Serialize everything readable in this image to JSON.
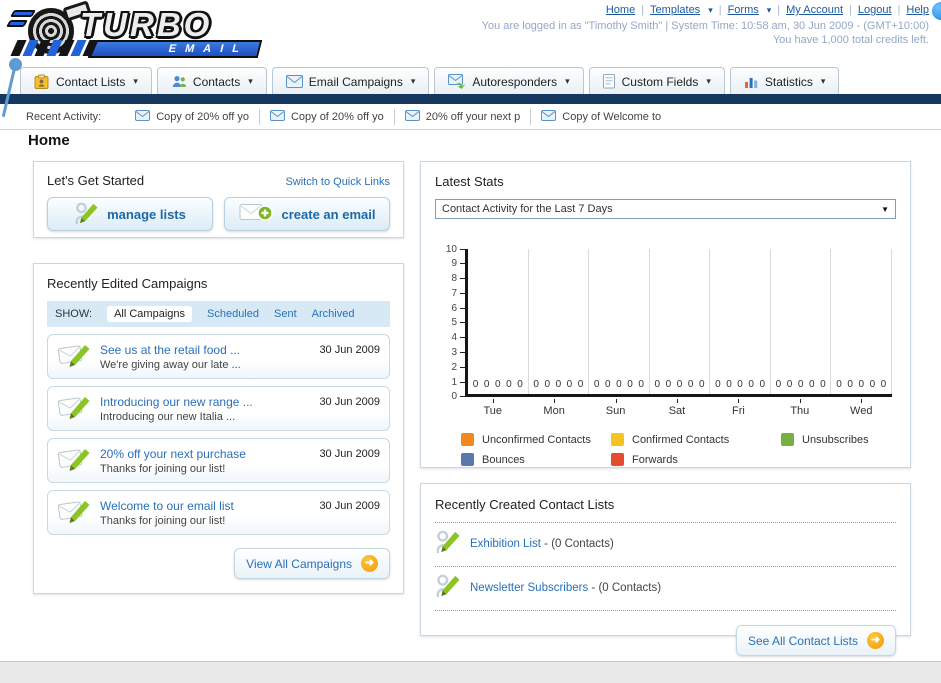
{
  "logo": {
    "title": "TURBO",
    "subtitle": "EMAIL"
  },
  "header": {
    "links": [
      {
        "label": "Home",
        "caret": false
      },
      {
        "label": "Templates",
        "caret": true
      },
      {
        "label": "Forms",
        "caret": true
      },
      {
        "label": "My Account",
        "caret": false
      },
      {
        "label": "Logout",
        "caret": false
      },
      {
        "label": "Help",
        "caret": false
      }
    ],
    "login_line": "You are logged in as \"Timothy Smith\" | System Time: 10:58 am, 30 Jun 2009 - (GMT+10:00)",
    "credits_line": "You have 1,000 total credits left."
  },
  "nav_tabs": [
    {
      "label": "Contact Lists",
      "icon": "contact-lists-icon"
    },
    {
      "label": "Contacts",
      "icon": "contacts-icon"
    },
    {
      "label": "Email Campaigns",
      "icon": "email-campaigns-icon"
    },
    {
      "label": "Autoresponders",
      "icon": "autoresponders-icon"
    },
    {
      "label": "Custom Fields",
      "icon": "custom-fields-icon"
    },
    {
      "label": "Statistics",
      "icon": "statistics-icon"
    }
  ],
  "recent_activity": {
    "label": "Recent Activity:",
    "items": [
      "Copy of 20% off yo",
      "Copy of 20% off yo",
      "20% off your next p",
      "Copy of Welcome to"
    ]
  },
  "page_title": "Home",
  "get_started": {
    "title": "Let's Get Started",
    "switch_link": "Switch to Quick Links",
    "buttons": [
      {
        "label": "manage lists",
        "icon": "manage-lists-icon"
      },
      {
        "label": "create an email",
        "icon": "create-email-icon"
      }
    ]
  },
  "campaigns": {
    "title": "Recently Edited Campaigns",
    "show_label": "SHOW:",
    "filters": [
      {
        "label": "All Campaigns",
        "active": true
      },
      {
        "label": "Scheduled",
        "active": false
      },
      {
        "label": "Sent",
        "active": false
      },
      {
        "label": "Archived",
        "active": false
      }
    ],
    "items": [
      {
        "title": "See us at the retail food ...",
        "subtitle": "We're giving away our late ...",
        "date": "30 Jun 2009"
      },
      {
        "title": "Introducing our new range ...",
        "subtitle": "Introducing our new Italia ...",
        "date": "30 Jun 2009"
      },
      {
        "title": "20% off your next purchase",
        "subtitle": "Thanks for joining our list!",
        "date": "30 Jun 2009"
      },
      {
        "title": "Welcome to our email list",
        "subtitle": "Thanks for joining our list!",
        "date": "30 Jun 2009"
      }
    ],
    "view_all_label": "View All Campaigns"
  },
  "stats": {
    "title": "Latest Stats",
    "selected_option": "Contact Activity for the Last 7 Days"
  },
  "chart_data": {
    "type": "bar",
    "title": "Contact Activity for the Last 7 Days",
    "categories": [
      "Tue",
      "Mon",
      "Sun",
      "Sat",
      "Fri",
      "Thu",
      "Wed"
    ],
    "series": [
      {
        "name": "Unconfirmed Contacts",
        "color": "#f18a1d",
        "values": [
          0,
          0,
          0,
          0,
          0,
          0,
          0
        ]
      },
      {
        "name": "Confirmed Contacts",
        "color": "#f6c41f",
        "values": [
          0,
          0,
          0,
          0,
          0,
          0,
          0
        ]
      },
      {
        "name": "Unsubscribes",
        "color": "#76b043",
        "values": [
          0,
          0,
          0,
          0,
          0,
          0,
          0
        ]
      },
      {
        "name": "Bounces",
        "color": "#5b77ad",
        "values": [
          0,
          0,
          0,
          0,
          0,
          0,
          0
        ]
      },
      {
        "name": "Forwards",
        "color": "#e64b2d",
        "values": [
          0,
          0,
          0,
          0,
          0,
          0,
          0
        ]
      }
    ],
    "xlabel": "",
    "ylabel": "",
    "ylim": [
      0,
      10
    ],
    "ytick_step": 1,
    "grid": "vertical-between-groups",
    "legend_position": "bottom",
    "value_labels_shown": true
  },
  "contact_lists": {
    "title": "Recently Created Contact Lists",
    "items": [
      {
        "name": "Exhibition List",
        "suffix": " - (0 Contacts)"
      },
      {
        "name": "Newsletter Subscribers",
        "suffix": " - (0 Contacts)"
      }
    ],
    "see_all_label": "See All Contact Lists"
  }
}
